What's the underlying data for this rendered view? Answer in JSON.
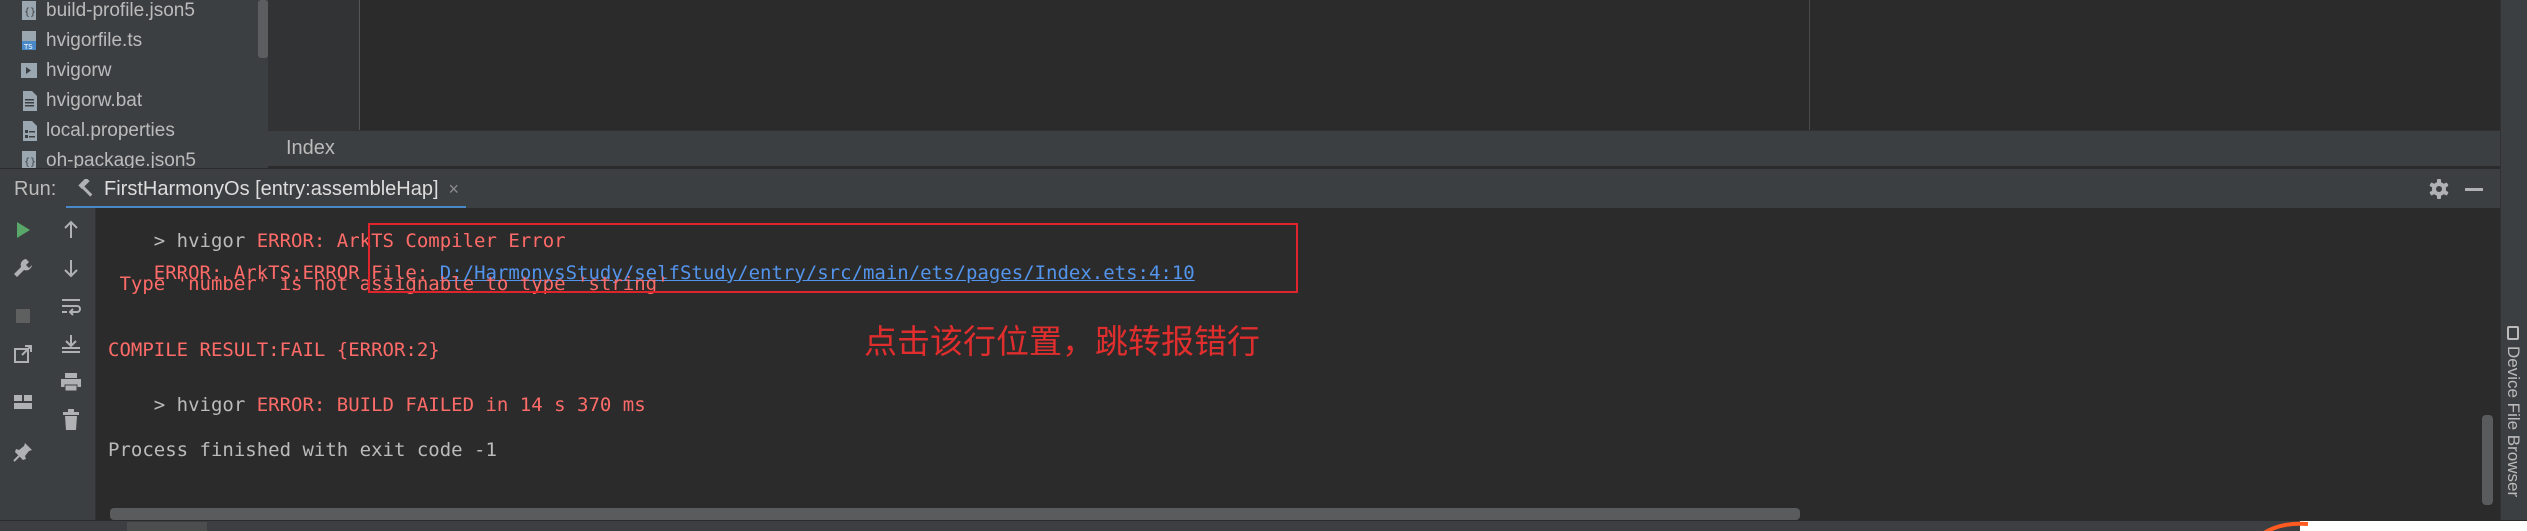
{
  "project_tree": {
    "items": [
      {
        "label": "build-profile.json5",
        "icon": "json-file-icon"
      },
      {
        "label": "hvigorfile.ts",
        "icon": "typescript-file-icon"
      },
      {
        "label": "hvigorw",
        "icon": "script-file-icon"
      },
      {
        "label": "hvigorw.bat",
        "icon": "text-file-icon"
      },
      {
        "label": "local.properties",
        "icon": "properties-file-icon"
      },
      {
        "label": "oh-package.json5",
        "icon": "json-file-icon"
      }
    ]
  },
  "editor": {
    "footer_label": "Index"
  },
  "run_window": {
    "label": "Run:",
    "tab_title": "FirstHarmonyOs [entry:assembleHap]",
    "tab_close": "×"
  },
  "console": {
    "line1_prefix": "> hvigor ",
    "line1_error": "ERROR: ArkTS Compiler Error",
    "line2_prefix": "ERROR: ArkTS:ERROR File: ",
    "line2_link": "D:/HarmonysStudy/selfStudy/entry/src/main/ets/pages/Index.ets:4:10",
    "line3": " Type 'number' is not assignable to type 'string'",
    "line4": "COMPILE RESULT:FAIL {ERROR:2}",
    "line5_prefix": "> hvigor ",
    "line5_error": "ERROR: BUILD FAILED in 14 s 370 ms",
    "line6": "Process finished with exit code -1"
  },
  "annotation": {
    "text": "点击该行位置，跳转报错行"
  },
  "right_stripe": {
    "device_file_browser": "Device File Browser"
  },
  "colors": {
    "error_red": "#ff6b68",
    "link_blue": "#5394ec",
    "annotation_red": "#e0242b",
    "panel_bg": "#3c3f41",
    "console_bg": "#2b2b2b"
  }
}
